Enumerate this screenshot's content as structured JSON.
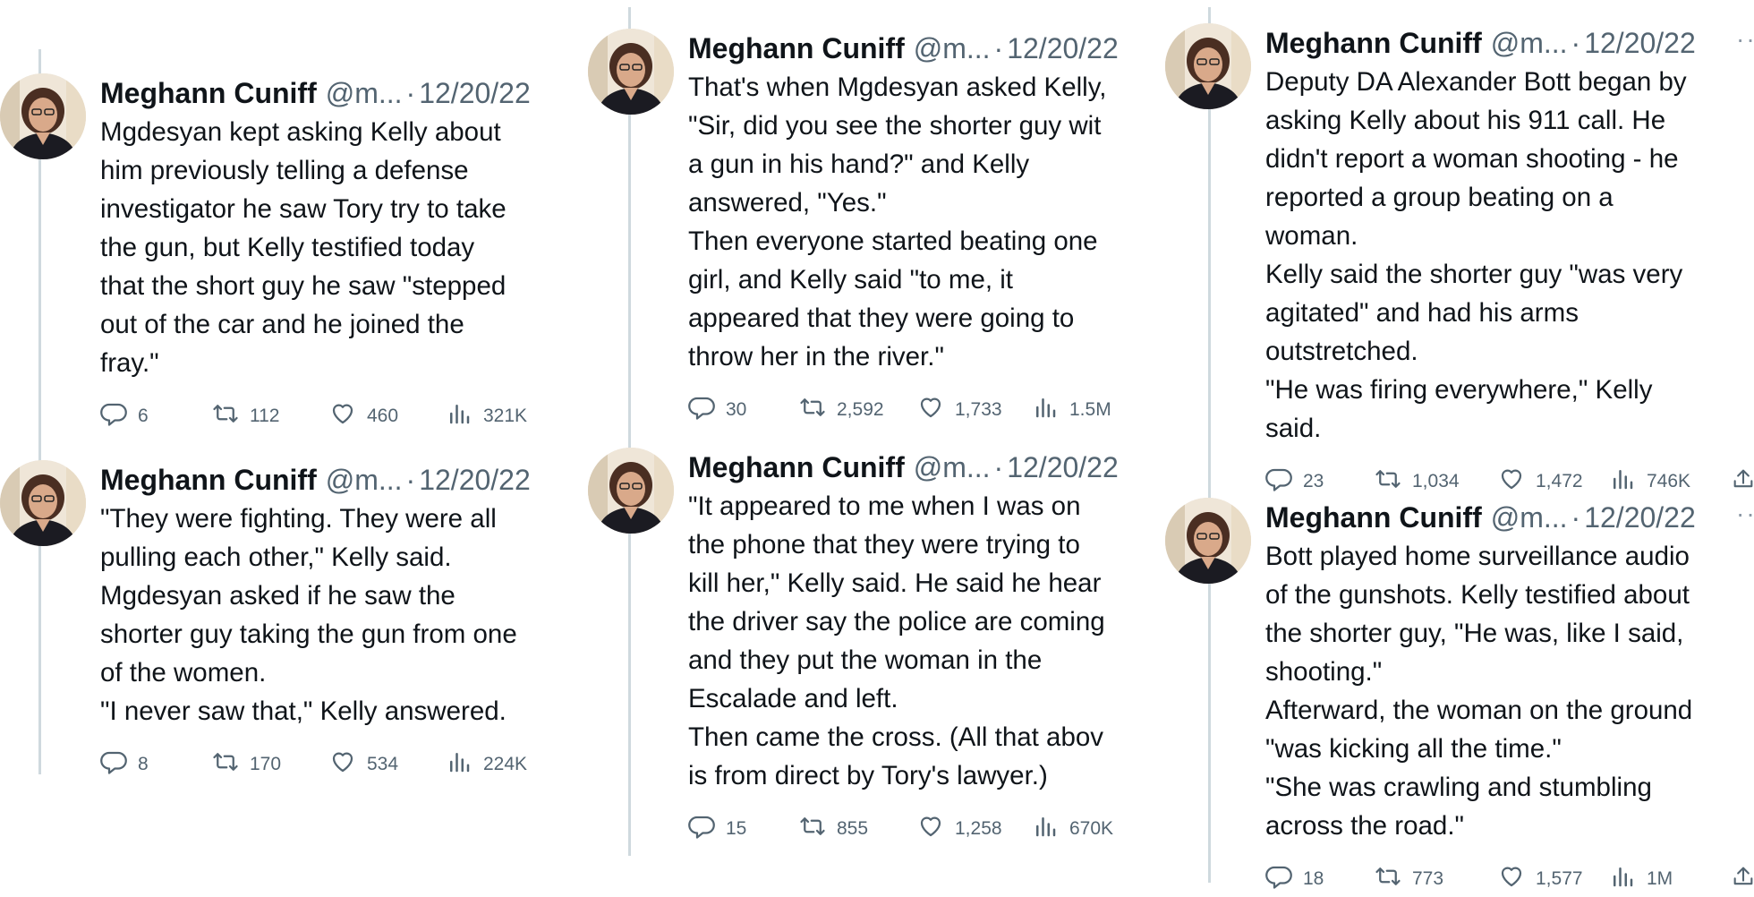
{
  "author": {
    "name": "Meghann Cuniff",
    "handle": "@m...",
    "separator": "·"
  },
  "columns": [
    {
      "tweets": [
        {
          "date": "12/20/22",
          "lines": [
            "Mgdesyan kept asking Kelly about",
            "him previously telling a defense",
            "investigator he saw Tory try to take",
            "the gun, but Kelly testified today",
            "that the short guy he saw \"stepped",
            "out of the car and he joined the",
            "fray.\""
          ],
          "replies": "6",
          "retweets": "112",
          "likes": "460",
          "views": "321K"
        },
        {
          "date": "12/20/22",
          "lines": [
            "\"They were fighting. They were all",
            "pulling each other,\" Kelly said.",
            "Mgdesyan asked if he saw the",
            "shorter guy taking the gun from one",
            "of the women.",
            "\"I never saw that,\" Kelly answered."
          ],
          "replies": "8",
          "retweets": "170",
          "likes": "534",
          "views": "224K"
        }
      ]
    },
    {
      "tweets": [
        {
          "date": "12/20/22",
          "lines": [
            "That's when Mgdesyan asked Kelly,",
            "\"Sir, did you see the shorter guy wit",
            "a gun in his hand?\" and Kelly",
            "answered, \"Yes.\"",
            "Then everyone started beating one",
            "girl, and Kelly said \"to me, it",
            "appeared that they were going to",
            "throw her in the river.\""
          ],
          "replies": "30",
          "retweets": "2,592",
          "likes": "1,733",
          "views": "1.5M"
        },
        {
          "date": "12/20/22",
          "lines": [
            "\"It appeared to me when I was on",
            "the phone that they were trying to",
            "kill her,\" Kelly said. He said he hear",
            "the driver say the police are coming",
            "and they put the woman in the",
            "Escalade and left.",
            "Then came the cross. (All that abov",
            "is from direct by Tory's lawyer.)"
          ],
          "replies": "15",
          "retweets": "855",
          "likes": "1,258",
          "views": "670K"
        }
      ]
    },
    {
      "tweets": [
        {
          "date": "12/20/22",
          "more": "···",
          "lines": [
            "Deputy DA Alexander Bott began by",
            "asking Kelly about his 911 call. He",
            "didn't report a woman shooting - he",
            "reported a group beating on a",
            "woman.",
            "Kelly said the shorter guy \"was very",
            "agitated\" and had his arms",
            "outstretched.",
            "\"He was firing everywhere,\" Kelly",
            "said."
          ],
          "replies": "23",
          "retweets": "1,034",
          "likes": "1,472",
          "views": "746K"
        },
        {
          "date": "12/20/22",
          "more": "···",
          "lines": [
            "Bott played home surveillance audio",
            "of the gunshots. Kelly testified about",
            "the shorter guy, \"He was, like I said,",
            "shooting.\"",
            "Afterward, the woman on the ground",
            "\"was kicking all the time.\"",
            "\"She was crawling and stumbling",
            "across the road.\""
          ],
          "replies": "18",
          "retweets": "773",
          "likes": "1,577",
          "views": "1M"
        }
      ]
    }
  ],
  "icons": {
    "reply": "reply-icon",
    "retweet": "retweet-icon",
    "like": "like-icon",
    "views": "views-icon",
    "share": "share-icon",
    "more": "more-icon"
  },
  "colors": {
    "text": "#0f1419",
    "secondary": "#536471",
    "thread_line": "#cfd9de"
  }
}
